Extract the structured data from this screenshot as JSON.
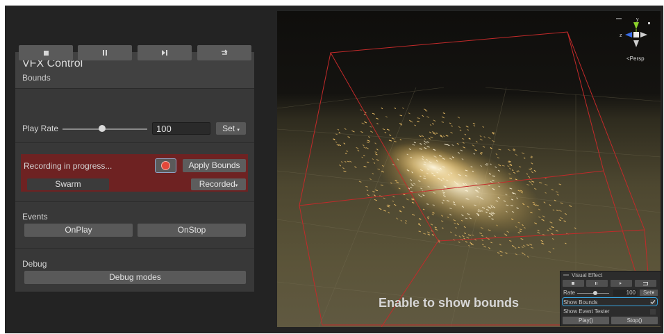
{
  "panel": {
    "title": "VFX Control",
    "subtitle": "Bounds",
    "transport": [
      {
        "icon": "stop-icon"
      },
      {
        "icon": "pause-icon"
      },
      {
        "icon": "step-icon"
      },
      {
        "icon": "restart-icon"
      }
    ],
    "play_rate_label": "Play Rate",
    "play_rate_value": "100",
    "play_rate_slider_fraction": 0.45,
    "set_label": "Set",
    "recording_label": "Recording in progress...",
    "apply_bounds_label": "Apply Bounds",
    "system_name": "Swarm",
    "bounds_mode": "Recorded",
    "events_label": "Events",
    "on_play_label": "OnPlay",
    "on_stop_label": "OnStop",
    "debug_label": "Debug",
    "debug_modes_label": "Debug modes"
  },
  "scene": {
    "view_mode": "<Persp",
    "caption": "Enable to show bounds",
    "gizmo_axis_y": "y",
    "gizmo_axis_z": "z",
    "bounds_color": "#c32a2a",
    "particle_color": "#fff2c8"
  },
  "overlay": {
    "title": "Visual Effect",
    "rate_label": "Rate",
    "rate_value": "100",
    "set_label": "Set",
    "show_bounds_label": "Show Bounds",
    "show_bounds_checked": true,
    "show_event_tester_label": "Show Event Tester",
    "play_label": "Play()",
    "stop_label": "Stop()"
  }
}
